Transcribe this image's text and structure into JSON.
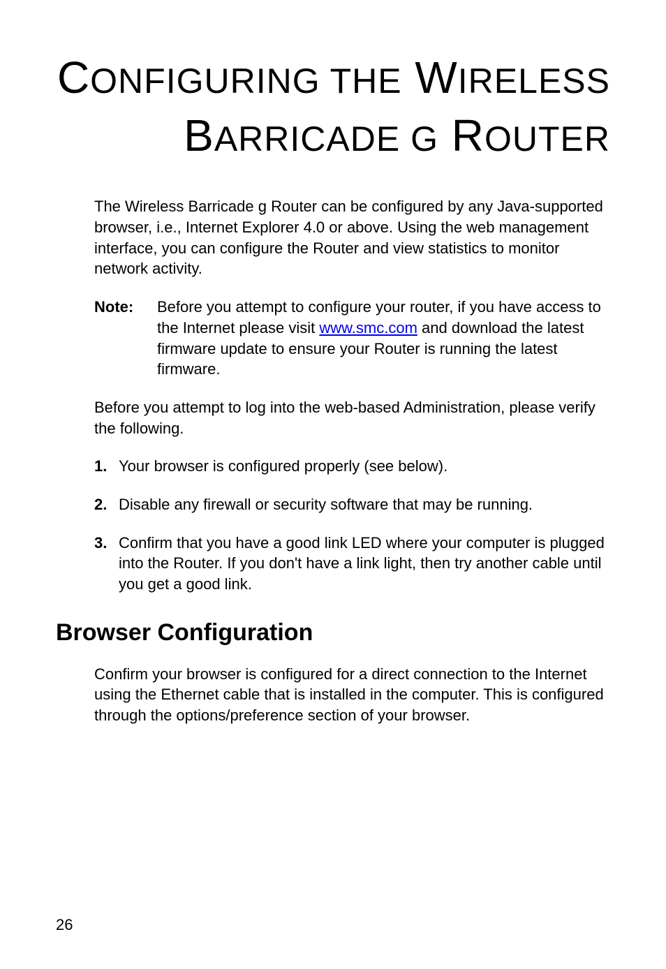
{
  "title_line1_parts": [
    "C",
    "ONFIGURING",
    " ",
    "THE",
    " W",
    "IRELESS"
  ],
  "title_line2_parts": [
    "B",
    "ARRICADE",
    " ",
    "G",
    " R",
    "OUTER"
  ],
  "intro": "The Wireless Barricade g Router can be configured by any Java-supported browser, i.e., Internet Explorer 4.0 or above. Using the web management interface, you can configure the Router and view statistics to monitor network activity.",
  "note_label": "Note:",
  "note_before_link": "Before you attempt to configure your router, if you have access to the Internet please visit ",
  "note_link": "www.smc.com",
  "note_after_link": " and download the latest firmware update to ensure your Router is running the latest firmware.",
  "verify": "Before you attempt to log into the web-based Administration, please verify the following.",
  "item1_num": "1.",
  "item1_text": "Your browser is configured properly (see below).",
  "item2_num": "2.",
  "item2_text": "Disable any firewall or security software that may be running.",
  "item3_num": "3.",
  "item3_text": "Confirm that you have a good link LED where your computer is plugged into the Router. If you don't have a link light, then try another cable until you get a good link.",
  "section_heading": "Browser Configuration",
  "section_para": "Confirm your browser is configured for a direct connection to the Internet using the Ethernet cable that is installed in the computer. This is configured through the options/preference section of your browser.",
  "page_number": "26"
}
